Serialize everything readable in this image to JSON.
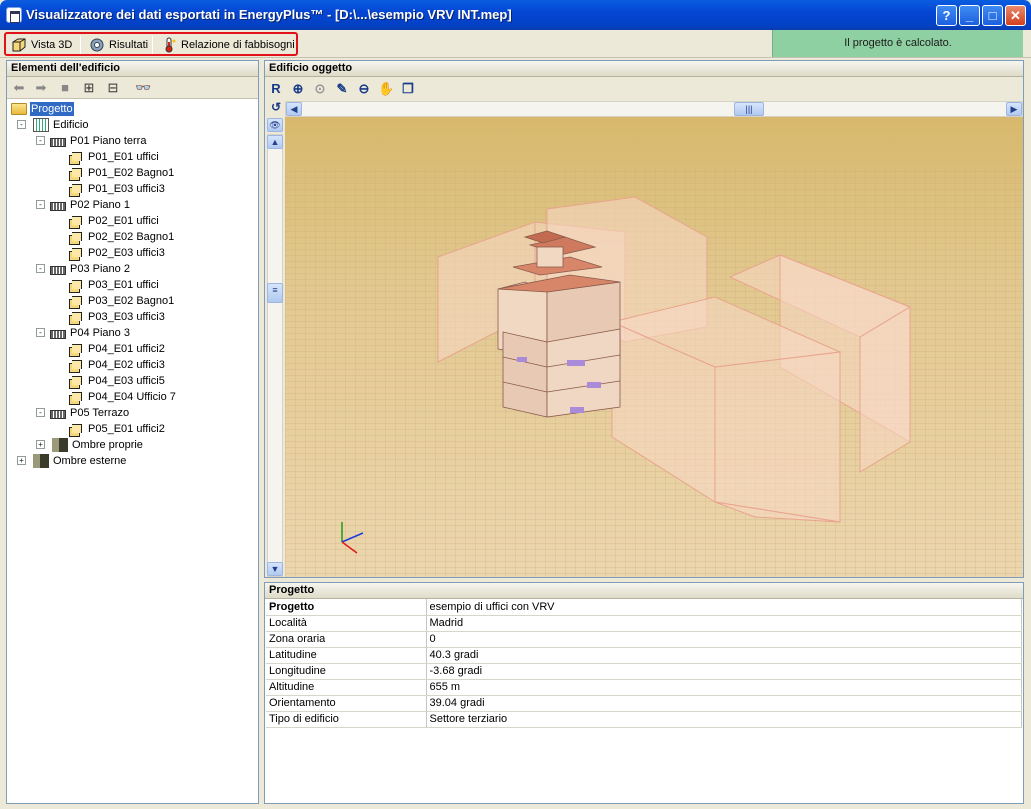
{
  "window": {
    "title": "Visualizzatore dei dati esportati in EnergyPlus™ - [D:\\...\\esempio VRV INT.mep]"
  },
  "toolbar": {
    "vista3d_label": "Vista 3D",
    "risultati_label": "Risultati",
    "relazione_label": "Relazione di fabbisogni",
    "status": "Il progetto è calcolato."
  },
  "tree": {
    "header": "Elementi dell'edificio",
    "root": "Progetto",
    "edificio": "Edificio",
    "floors": [
      {
        "label": "P01 Piano terra",
        "zones": [
          "P01_E01 uffici",
          "P01_E02 Bagno1",
          "P01_E03 uffici3"
        ]
      },
      {
        "label": "P02 Piano 1",
        "zones": [
          "P02_E01 uffici",
          "P02_E02 Bagno1",
          "P02_E03 uffici3"
        ]
      },
      {
        "label": "P03 Piano 2",
        "zones": [
          "P03_E01 uffici",
          "P03_E02 Bagno1",
          "P03_E03 uffici3"
        ]
      },
      {
        "label": "P04 Piano 3",
        "zones": [
          "P04_E01 uffici2",
          "P04_E02 uffici3",
          "P04_E03 uffici5",
          "P04_E04 Ufficio 7"
        ]
      },
      {
        "label": "P05 Terrazo",
        "zones": [
          "P05_E01 uffici2"
        ]
      }
    ],
    "ombre_proprie": "Ombre proprie",
    "ombre_esterne": "Ombre esterne"
  },
  "view": {
    "header": "Edificio oggetto"
  },
  "info": {
    "header": "Progetto",
    "rows": [
      {
        "key": "Progetto",
        "value": "esempio di uffici con VRV"
      },
      {
        "key": "Località",
        "value": "Madrid"
      },
      {
        "key": "Zona oraria",
        "value": "0"
      },
      {
        "key": "Latitudine",
        "value": "40.3 gradi"
      },
      {
        "key": "Longitudine",
        "value": "-3.68 gradi"
      },
      {
        "key": "Altitudine",
        "value": "655 m"
      },
      {
        "key": "Orientamento",
        "value": "39.04 gradi"
      },
      {
        "key": "Tipo di edificio",
        "value": "Settore terziario"
      }
    ]
  },
  "colors": {
    "titlebar": "#0446d4",
    "status_bg": "#8fd0a3",
    "highlight": "#e0121a",
    "scene_bg": "#d9bb73",
    "selection": "#316ac5"
  }
}
